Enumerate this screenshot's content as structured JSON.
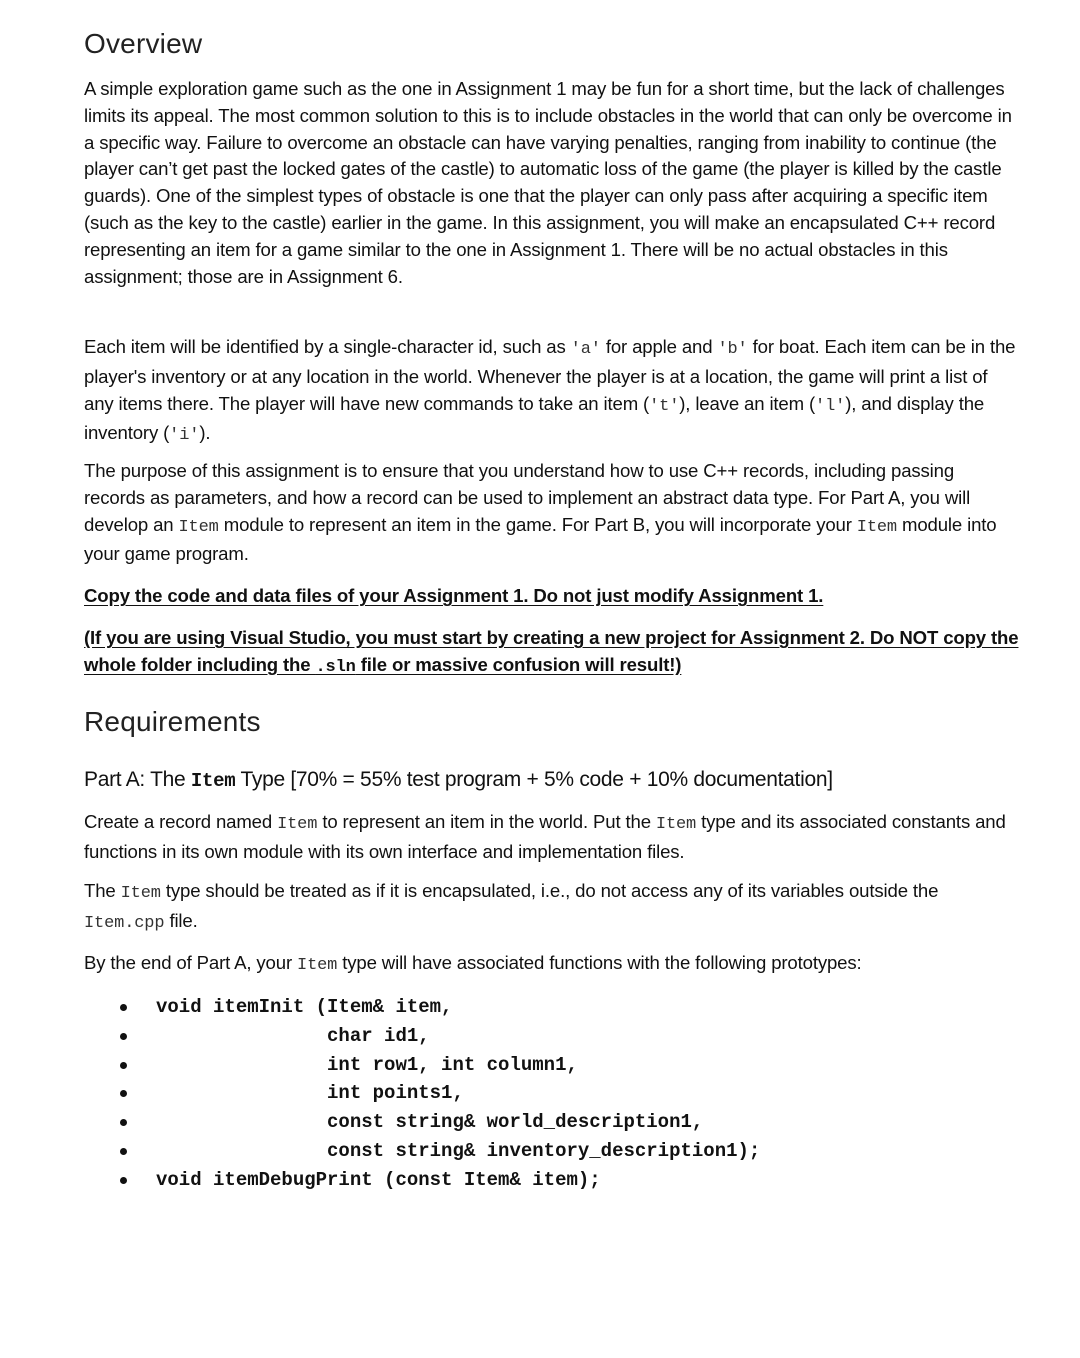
{
  "overview": {
    "heading": "Overview",
    "p1": "A simple exploration game such as the one in Assignment 1 may be fun for a short time, but the lack of challenges limits its appeal.  The most common solution to this is to include obstacles in the world that can only be overcome in a specific way.  Failure to overcome an obstacle can have varying penalties, ranging from inability to continue (the player can’t get past the locked gates of the castle) to automatic loss of the game (the player is killed by the castle guards).  One of the simplest types of obstacle is one that the player can only pass after acquiring a specific item (such as the key to the castle) earlier in the game.  In this assignment, you will make an encapsulated C++ record representing an item for a game similar to the one in Assignment 1.  There will be no actual obstacles in this assignment; those are in Assignment 6.",
    "p2": {
      "t1": "Each item will be identified by a single-character id, such as ",
      "c1": "'a'",
      "t2": " for apple and ",
      "c2": "'b'",
      "t3": " for boat.  Each item can be in the player's inventory or at any location in the world.  Whenever the player is at a location, the game will print a list of any items there.  The player will have new commands to take an item (",
      "c3": "'t'",
      "t4": "), leave an item (",
      "c4": "'l'",
      "t5": "), and display the inventory (",
      "c5": "'i'",
      "t6": ")."
    },
    "p3": {
      "t1": "The purpose of this assignment is to ensure that you understand how to use C++ records, including passing records as parameters, and how a record can be used to implement an abstract data type. For Part A, you will develop an ",
      "c1": "Item",
      "t2": " module to represent an item in the game.  For Part B, you will incorporate your ",
      "c2": "Item",
      "t3": " module into your game program."
    },
    "warning1": "Copy the code and data files of your Assignment 1.  Do not just modify Assignment 1.",
    "warning2": {
      "t1": "(If you are using Visual Studio, you must start by creating a new project for Assignment 2.  Do NOT copy the whole folder including the ",
      "c1": ".sln",
      "t2": " file or massive confusion will result!)"
    }
  },
  "requirements": {
    "heading": "Requirements",
    "part_a": {
      "heading_t1": "Part A: The ",
      "heading_code": "Item",
      "heading_t2": " Type [70% = 55% test program + 5% code + 10% documentation]",
      "p1": {
        "t1": "Create a record named ",
        "c1": "Item",
        "t2": " to represent an item in the world.  Put the ",
        "c2": "Item",
        "t3": " type and its associated constants and functions in its own module with its own interface and implementation files."
      },
      "p2": {
        "t1": "The ",
        "c1": "Item",
        "t2": " type should be treated as if it is encapsulated, i.e., do not access any of its variables outside the ",
        "c2": "Item.cpp",
        "t3": " file."
      },
      "p3": {
        "t1": "By the end of Part A, your ",
        "c1": "Item",
        "t2": " type will have associated functions with the following prototypes:"
      },
      "prototypes": [
        "void itemInit (Item& item,",
        "               char id1,",
        "               int row1, int column1,",
        "               int points1,",
        "               const string& world_description1,",
        "               const string& inventory_description1);",
        "void itemDebugPrint (const Item& item);"
      ]
    }
  }
}
